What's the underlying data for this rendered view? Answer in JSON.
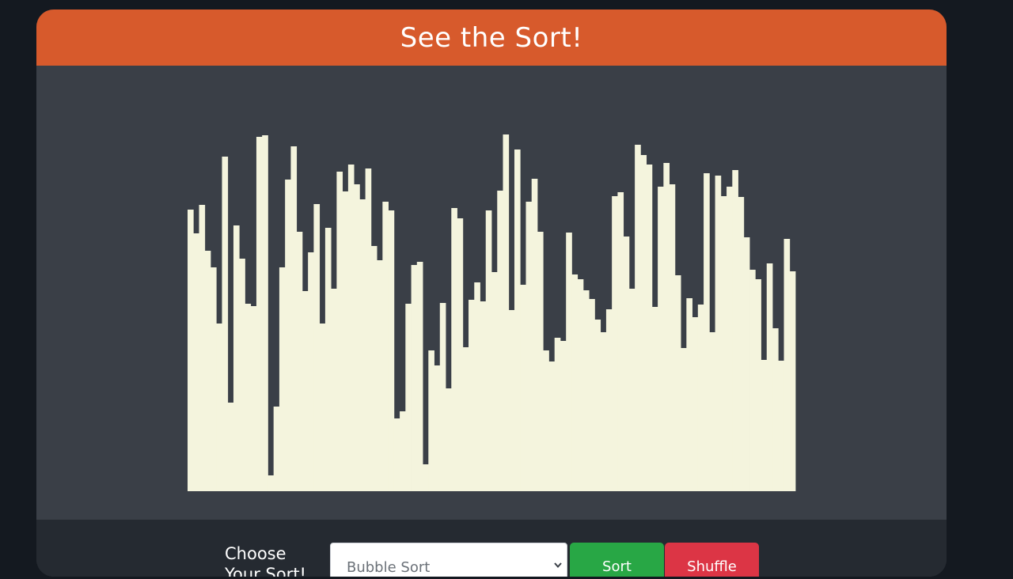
{
  "header": {
    "title": "See the Sort!"
  },
  "colors": {
    "header_bg": "#d75a2c",
    "panel_bg": "#3a3f47",
    "bar_color": "#f4f4dd",
    "controls_bg": "#252a31",
    "sort_button": "#28a745",
    "shuffle_button": "#dc3545"
  },
  "visualizer": {
    "bar_heights": [
      356,
      326,
      362,
      304,
      283,
      212,
      423,
      112,
      336,
      294,
      237,
      234,
      448,
      450,
      20,
      107,
      283,
      394,
      436,
      328,
      253,
      302,
      363,
      212,
      333,
      256,
      404,
      379,
      413,
      388,
      369,
      408,
      310,
      292,
      366,
      355,
      92,
      101,
      237,
      286,
      290,
      34,
      178,
      159,
      238,
      130,
      358,
      345,
      182,
      242,
      264,
      240,
      355,
      277,
      380,
      451,
      229,
      432,
      261,
      366,
      395,
      328,
      178,
      164,
      194,
      190,
      327,
      274,
      268,
      254,
      243,
      217,
      201,
      230,
      373,
      378,
      322,
      256,
      438,
      425,
      413,
      233,
      385,
      415,
      388,
      273,
      181,
      244,
      220,
      236,
      402,
      201,
      399,
      373,
      385,
      406,
      372,
      321,
      280,
      268,
      166,
      288,
      206,
      165,
      319,
      278
    ]
  },
  "controls": {
    "choose_label": "Choose Your Sort!",
    "select": {
      "selected": "Bubble Sort"
    },
    "sort_label": "Sort",
    "shuffle_label": "Shuffle",
    "dropdown_icon": "chevron-down-icon"
  }
}
